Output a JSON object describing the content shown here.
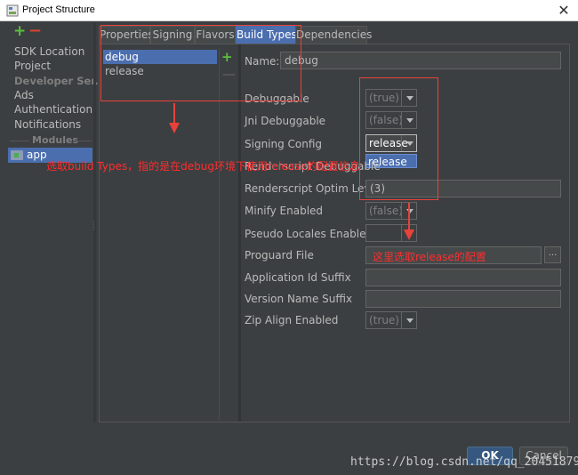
{
  "window": {
    "title": "Project Structure",
    "close_glyph": "✕"
  },
  "sidebar": {
    "add_glyph": "+",
    "remove_glyph": "−",
    "items": [
      {
        "label": "SDK Location"
      },
      {
        "label": "Project"
      },
      {
        "label": "Developer Ser..."
      },
      {
        "label": "Ads"
      },
      {
        "label": "Authentication"
      },
      {
        "label": "Notifications"
      }
    ],
    "modules_header": "Modules",
    "module_app": "app"
  },
  "tabs": [
    {
      "label": "Properties"
    },
    {
      "label": "Signing"
    },
    {
      "label": "Flavors"
    },
    {
      "label": "Build Types",
      "active": true
    },
    {
      "label": "Dependencies"
    }
  ],
  "build_types": {
    "items": [
      "debug",
      "release"
    ],
    "selected": "debug",
    "add_glyph": "+",
    "remove_glyph": "—"
  },
  "form": {
    "name_label": "Name:",
    "name_value": "debug",
    "debuggable_label": "Debuggable",
    "debuggable_value": "(true)",
    "jni_label": "Jni Debuggable",
    "jni_value": "(false)",
    "signing_label": "Signing Config",
    "signing_value": "release",
    "signing_option": "release",
    "renderscript_debug_label": "Renderscript Debuggable",
    "renderscript_optim_label": "Renderscript Optim Level",
    "renderscript_optim_value": "(3)",
    "minify_label": "Minify Enabled",
    "minify_value": "(false)",
    "pseudo_label": "Pseudo Locales Enabled",
    "proguard_label": "Proguard File",
    "browse_label": "...",
    "app_id_suffix_label": "Application Id Suffix",
    "version_suffix_label": "Version Name Suffix",
    "zip_align_label": "Zip Align Enabled",
    "zip_align_value": "(true)"
  },
  "annotations": {
    "note1": "选取build Types，指的是在debug环境下使用release的配置信息",
    "note2": "这里选取release的配置",
    "color": "#ff2d2d"
  },
  "buttons": {
    "ok": "OK",
    "cancel": "Cancel"
  },
  "watermark": "https://blog.csdn.net/qq_20451879",
  "colors": {
    "accent": "#4b6eaf",
    "background": "#3c3f41",
    "annotation": "#e8423a"
  }
}
